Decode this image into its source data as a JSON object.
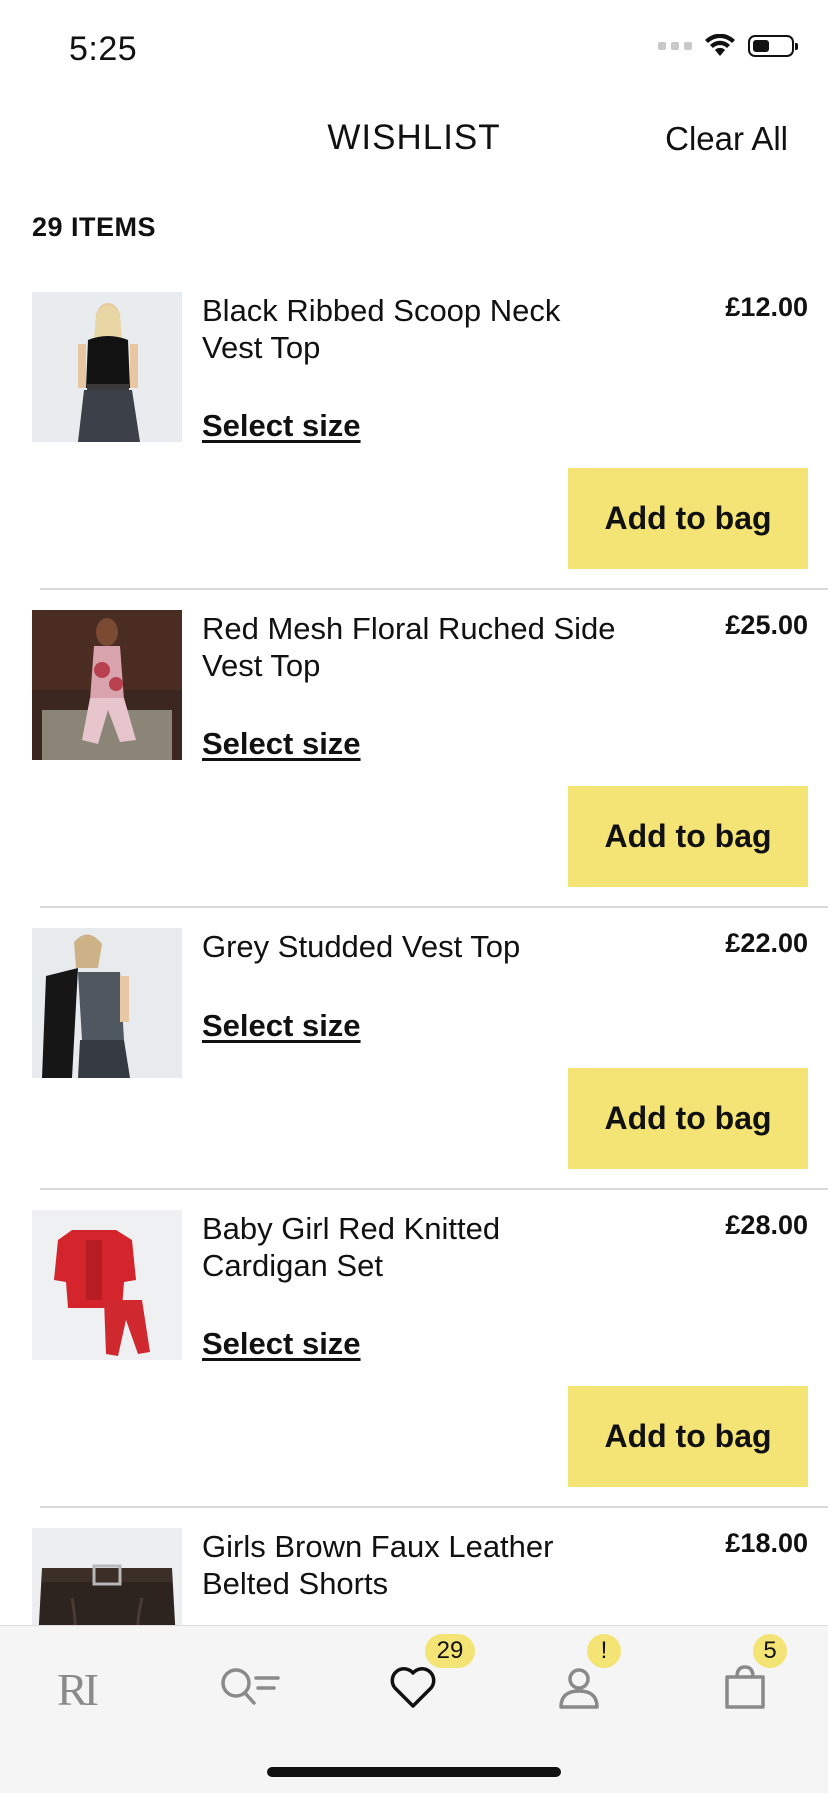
{
  "status": {
    "time": "5:25"
  },
  "header": {
    "title": "WISHLIST",
    "clear_all": "Clear All"
  },
  "items_count": "29 ITEMS",
  "items": [
    {
      "name": "Black Ribbed Scoop Neck Vest Top",
      "price": "£12.00",
      "select_size": "Select size",
      "add_label": "Add to bag"
    },
    {
      "name": "Red Mesh Floral Ruched Side Vest Top",
      "price": "£25.00",
      "select_size": "Select size",
      "add_label": "Add to bag"
    },
    {
      "name": "Grey Studded Vest Top",
      "price": "£22.00",
      "select_size": "Select size",
      "add_label": "Add to bag"
    },
    {
      "name": "Baby Girl Red Knitted Cardigan Set",
      "price": "£28.00",
      "select_size": "Select size",
      "add_label": "Add to bag"
    },
    {
      "name": "Girls Brown Faux Leather Belted Shorts",
      "price": "£18.00"
    }
  ],
  "tab_bar": {
    "tabs": [
      {
        "icon": "ri-logo-icon",
        "label": "RI"
      },
      {
        "icon": "search-icon"
      },
      {
        "icon": "heart-icon",
        "badge": "29"
      },
      {
        "icon": "account-icon",
        "badge": "!"
      },
      {
        "icon": "bag-icon",
        "badge": "5"
      }
    ]
  },
  "colors": {
    "accent": "#f4e475",
    "text": "#111111",
    "divider": "#d9d9d9",
    "tab_bar_bg": "#f5f5f5"
  }
}
